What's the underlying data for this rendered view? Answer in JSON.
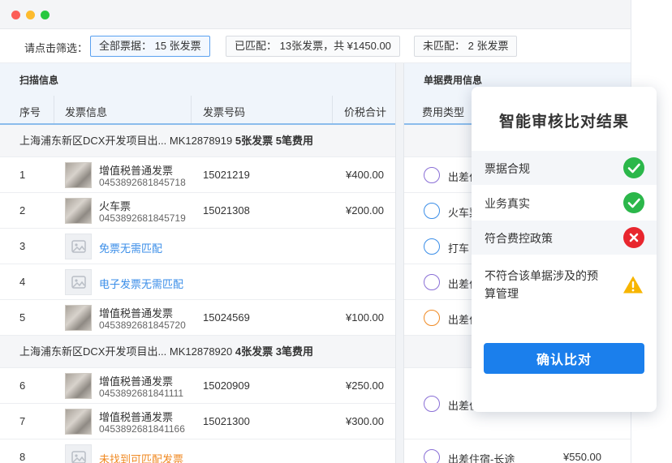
{
  "filter": {
    "label": "请点击筛选：",
    "chips": [
      {
        "text": "全部票据： 15 张发票",
        "active": true
      },
      {
        "text": "已匹配： 13张发票，共 ¥1450.00",
        "active": false
      },
      {
        "text": "未匹配： 2 张发票",
        "active": false
      }
    ]
  },
  "left": {
    "section_title": "扫描信息",
    "columns": [
      "序号",
      "发票信息",
      "发票号码",
      "价税合计"
    ],
    "groups": [
      {
        "prefix": "上海浦东新区DCX开发项目出...   MK12878919",
        "invoice_count": "5张发票",
        "fee_count": "5笔费用",
        "rows": [
          {
            "idx": "1",
            "type": "thumb",
            "name": "增值税普通发票",
            "code": "0453892681845718",
            "number": "15021219",
            "amount": "¥400.00"
          },
          {
            "idx": "2",
            "type": "thumb",
            "name": "火车票",
            "code": "0453892681845719",
            "number": "15021308",
            "amount": "¥200.00"
          },
          {
            "idx": "3",
            "type": "blue",
            "name": "免票无需匹配",
            "code": "",
            "number": "",
            "amount": ""
          },
          {
            "idx": "4",
            "type": "blue",
            "name": "电子发票无需匹配",
            "code": "",
            "number": "",
            "amount": ""
          },
          {
            "idx": "5",
            "type": "thumb",
            "name": "增值税普通发票",
            "code": "0453892681845720",
            "number": "15024569",
            "amount": "¥100.00"
          }
        ]
      },
      {
        "prefix": "上海浦东新区DCX开发项目出...   MK12878920",
        "invoice_count": "4张发票",
        "fee_count": "3笔费用",
        "rows": [
          {
            "idx": "6",
            "type": "thumb",
            "name": "增值税普通发票",
            "code": "0453892681841111",
            "number": "15020909",
            "amount": "¥250.00"
          },
          {
            "idx": "7",
            "type": "thumb",
            "name": "增值税普通发票",
            "code": "0453892681841166",
            "number": "15021300",
            "amount": "¥300.00"
          },
          {
            "idx": "8",
            "type": "orange",
            "name": "未找到可匹配发票",
            "code": "",
            "number": "",
            "amount": ""
          }
        ]
      }
    ]
  },
  "right": {
    "section_title": "单据费用信息",
    "column": "费用类型",
    "items": [
      {
        "text": "出差住",
        "icon": "bed-icon",
        "color": "#8a6fd6",
        "amount": ""
      },
      {
        "text": "火车票",
        "icon": "train-icon",
        "color": "#3b8ee8",
        "amount": ""
      },
      {
        "text": "打车",
        "icon": "taxi-icon",
        "color": "#3b8ee8",
        "amount": ""
      },
      {
        "text": "出差住",
        "icon": "bed-icon",
        "color": "#8a6fd6",
        "amount": ""
      },
      {
        "text": "出差住",
        "icon": "meal-icon",
        "color": "#f08a24",
        "amount": ""
      },
      {
        "text": "出差住",
        "icon": "bed-icon",
        "color": "#8a6fd6",
        "amount": ""
      },
      {
        "text": "出差住宿-长途",
        "icon": "bed-icon",
        "color": "#8a6fd6",
        "amount": "¥550.00"
      }
    ]
  },
  "panel": {
    "title": "智能审核比对结果",
    "checks": [
      {
        "text": "票据合规",
        "status": "ok"
      },
      {
        "text": "业务真实",
        "status": "ok"
      },
      {
        "text": "符合费控政策",
        "status": "bad"
      },
      {
        "text": "不符合该单据涉及的预算管理",
        "status": "warn"
      }
    ],
    "confirm": "确认比对"
  }
}
